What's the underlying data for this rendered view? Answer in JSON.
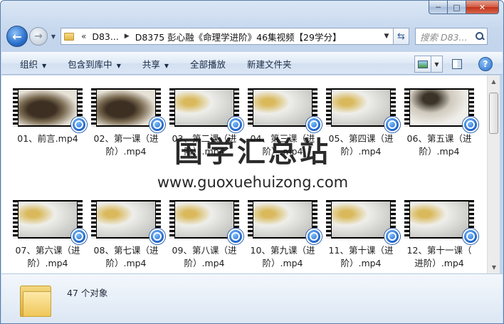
{
  "window": {
    "caption_min": "─",
    "caption_max": "□",
    "caption_close": "✕"
  },
  "nav": {
    "back_glyph": "←",
    "forward_glyph": "→",
    "breadcrumb_lead": "«",
    "breadcrumb": [
      "D83...",
      "D8375 彭心融《命理学进阶》46集视频【29学分】"
    ],
    "search_placeholder": "搜索 D83..."
  },
  "commands": {
    "organize": "组织",
    "include_library": "包含到库中",
    "share": "共享",
    "play_all": "全部播放",
    "new_folder": "新建文件夹"
  },
  "files": [
    {
      "label": "01、前言.mp4",
      "thumb": "dark"
    },
    {
      "label": "02、第一课（进\n阶）.mp4",
      "thumb": "dark"
    },
    {
      "label": "03、第二课（进\n阶）.mp4",
      "thumb": "light"
    },
    {
      "label": "04、第三课（进\n阶）.mp4",
      "thumb": "light"
    },
    {
      "label": "05、第四课（进\n阶）.mp4",
      "thumb": "light"
    },
    {
      "label": "06、第五课（进\n阶）.mp4",
      "thumb": "bird"
    },
    {
      "label": "07、第六课（进\n阶）.mp4",
      "thumb": "light"
    },
    {
      "label": "08、第七课（进\n阶）.mp4",
      "thumb": "light"
    },
    {
      "label": "09、第八课（进\n阶）.mp4",
      "thumb": "light"
    },
    {
      "label": "10、第九课（进\n阶）.mp4",
      "thumb": "light"
    },
    {
      "label": "11、第十课（进\n阶）.mp4",
      "thumb": "light"
    },
    {
      "label": "12、第十一课（\n进阶）.mp4",
      "thumb": "light"
    }
  ],
  "watermark": {
    "title": "国学汇总站",
    "url": "www.guoxuehuizong.com"
  },
  "details": {
    "count": "47 个对象"
  }
}
